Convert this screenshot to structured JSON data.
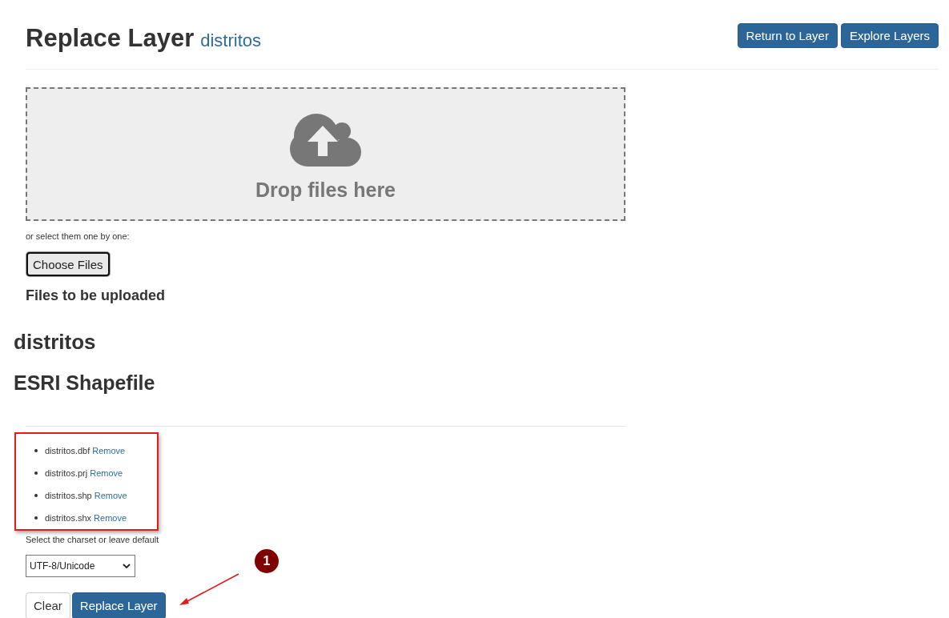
{
  "header": {
    "title": "Replace Layer",
    "subtitle": "distritos",
    "buttons": [
      {
        "label": "Return to Layer",
        "kind": "primary"
      },
      {
        "label": "Explore Layers",
        "kind": "primary"
      }
    ]
  },
  "dropzone": {
    "message": "Drop files here"
  },
  "file_picker": {
    "hint": "or select them one by one:",
    "button": "Choose Files"
  },
  "upload_heading": "Files to be uploaded",
  "layer": {
    "name": "distritos",
    "format": "ESRI Shapefile"
  },
  "files": [
    {
      "name": "distritos.dbf",
      "action": "Remove"
    },
    {
      "name": "distritos.prj",
      "action": "Remove"
    },
    {
      "name": "distritos.shp",
      "action": "Remove"
    },
    {
      "name": "distritos.shx",
      "action": "Remove"
    }
  ],
  "charset": {
    "label": "Select the charset or leave default",
    "value": "UTF-8/Unicode"
  },
  "actions": [
    {
      "label": "Clear",
      "kind": "default"
    },
    {
      "label": "Replace Layer",
      "kind": "primary"
    }
  ],
  "annotation": {
    "badge": "1"
  }
}
